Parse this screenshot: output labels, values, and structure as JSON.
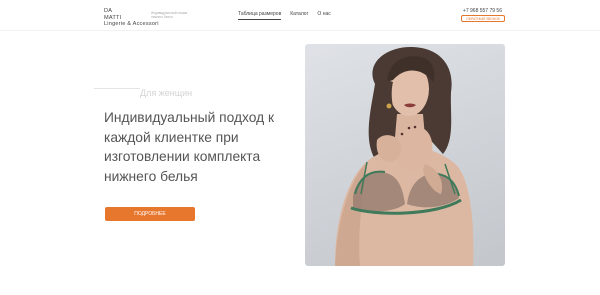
{
  "brand": {
    "line1": "DA",
    "line2": "MATTI",
    "line3": "Lingerie & Accessori",
    "tagline": "Индивидуальный пошив нижнего белья"
  },
  "nav": {
    "items": [
      "Таблица размеров",
      "Каталог",
      "О нас"
    ],
    "active_index": 0
  },
  "contact": {
    "phone": "+7 968 557 79 56",
    "callback_label": "ОБРАТНЫЙ ЗВОНОК"
  },
  "hero": {
    "subtitle": "Для женщин",
    "headline": "Индивидуальный подход к каждой клиентке при изготовлении комплекта нижнего белья",
    "button_label": "ПОДРОБНЕЕ"
  },
  "colors": {
    "accent": "#e8772e",
    "text": "#555555"
  }
}
